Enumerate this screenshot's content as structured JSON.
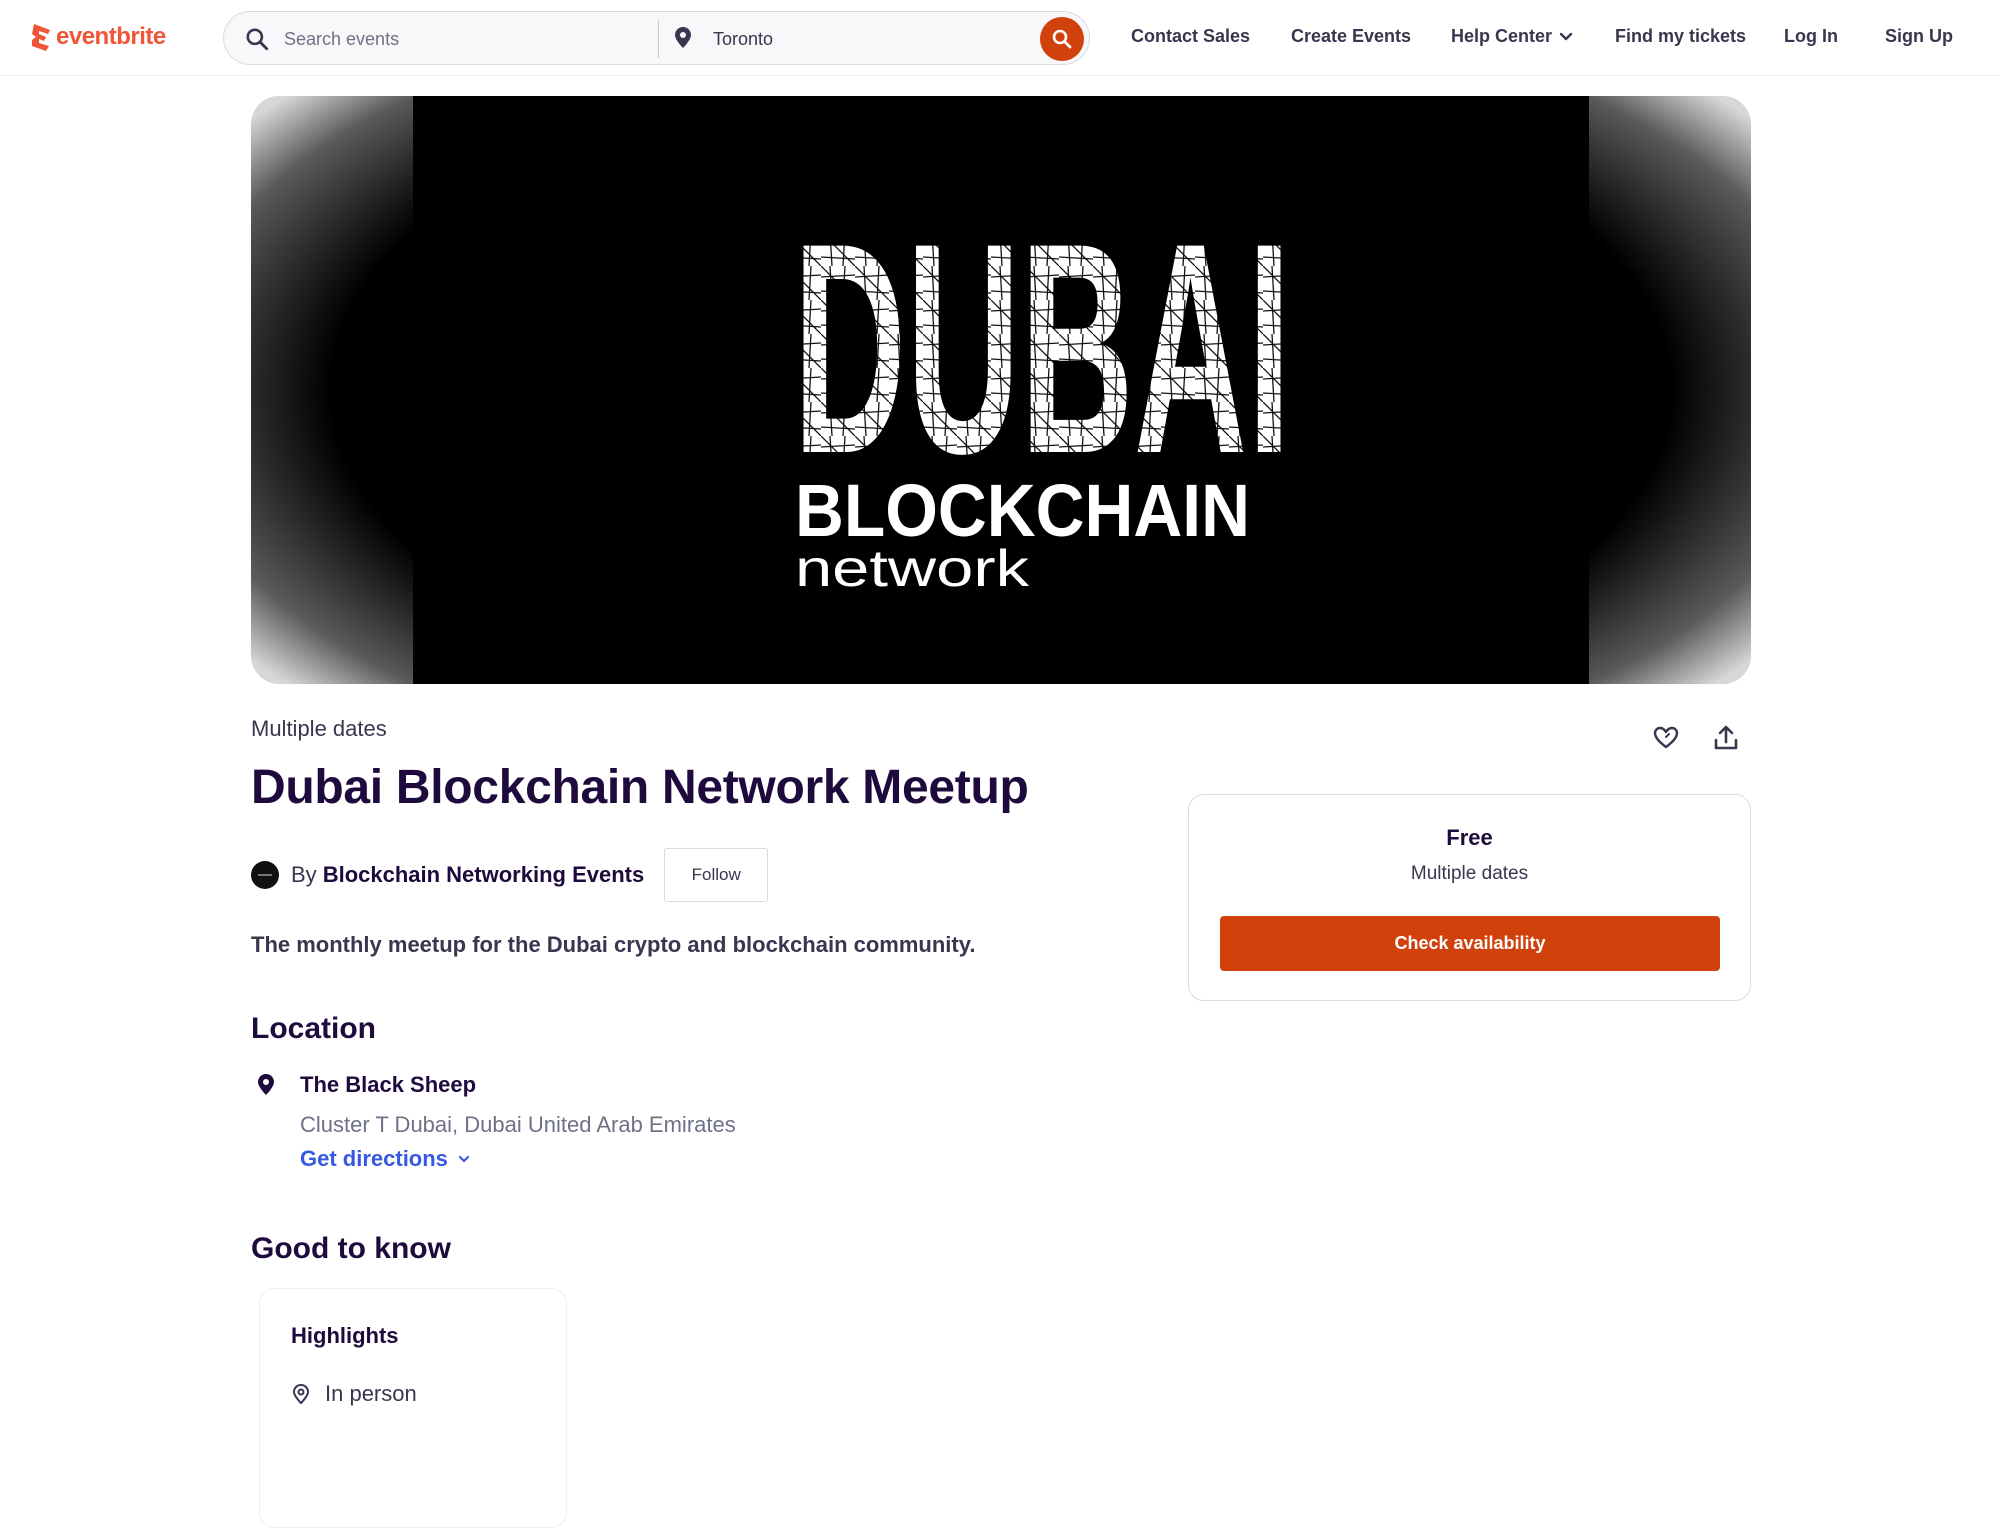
{
  "brand": {
    "logo_text": "eventbrite",
    "accent": "#f05537",
    "primary_button": "#d1410c",
    "title_color": "#1e0a3c",
    "link_color": "#3659e3"
  },
  "header": {
    "search": {
      "placeholder": "Search events",
      "location_value": "Toronto",
      "button_icon": "search-icon"
    },
    "nav": [
      {
        "label": "Contact Sales"
      },
      {
        "label": "Create Events"
      },
      {
        "label": "Help Center",
        "icon": "chevron-down-icon"
      },
      {
        "label": "Find my tickets"
      },
      {
        "label": "Log In"
      },
      {
        "label": "Sign Up"
      }
    ]
  },
  "hero": {
    "line1": "DUBAI",
    "line2": "BLOCKCHAIN",
    "line3": "network"
  },
  "event": {
    "date_label": "Multiple dates",
    "title": "Dubai Blockchain Network Meetup",
    "organizer_prefix": "By",
    "organizer_name": "Blockchain Networking Events",
    "follow_label": "Follow",
    "summary": "The monthly meetup for the Dubai crypto and blockchain community.",
    "actions": {
      "like_icon": "heart-icon",
      "share_icon": "share-icon"
    }
  },
  "location": {
    "heading": "Location",
    "venue": "The Black Sheep",
    "address": "Cluster T Dubai, Dubai United Arab Emirates",
    "directions_label": "Get directions"
  },
  "good_to_know": {
    "heading": "Good to know",
    "highlights_title": "Highlights",
    "highlights": [
      {
        "icon": "location-pin-icon",
        "label": "In person"
      }
    ]
  },
  "ticket": {
    "price": "Free",
    "dates": "Multiple dates",
    "cta_label": "Check availability"
  }
}
